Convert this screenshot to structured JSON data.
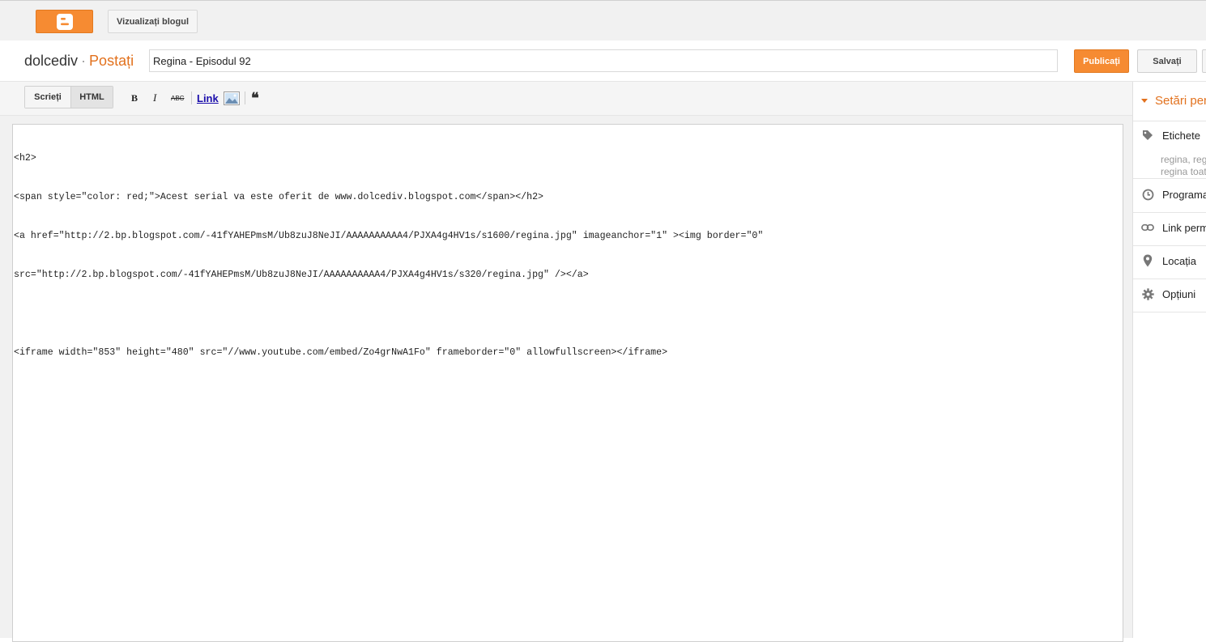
{
  "topbar": {
    "logo_icon": "blogger-logo-icon",
    "view_blog_label": "Vizualizați blogul"
  },
  "header": {
    "blog_name": "dolcediv",
    "separator": "·",
    "section": "Postați",
    "post_title_value": "Regina - Episodul 92",
    "publish_label": "Publicați",
    "save_label": "Salvați"
  },
  "toolbar": {
    "compose_label": "Scrieți",
    "html_label": "HTML",
    "bold_label": "B",
    "italic_label": "I",
    "strike_label": "ABC",
    "link_label": "Link",
    "quote_label": "❝"
  },
  "editor": {
    "lines": [
      "<h2>",
      "<span style=\"color: red;\">Acest serial va este oferit de www.dolcediv.blogspot.com</span></h2>",
      "<a href=\"http://2.bp.blogspot.com/-41fYAHEPmsM/Ub8zuJ8NeJI/AAAAAAAAAA4/PJXA4g4HV1s/s1600/regina.jpg\" imageanchor=\"1\" ><img border=\"0\"",
      "src=\"http://2.bp.blogspot.com/-41fYAHEPmsM/Ub8zuJ8NeJI/AAAAAAAAAA4/PJXA4g4HV1s/s320/regina.jpg\" /></a>",
      "",
      "<iframe width=\"853\" height=\"480\" src=\"//www.youtube.com/embed/Zo4grNwA1Fo\" frameborder=\"0\" allowfullscreen></iframe>"
    ]
  },
  "sidebar": {
    "title": "Setări pentru postare",
    "items": [
      {
        "label": "Etichete",
        "icon": "tag-icon",
        "sub": [
          "regina, regina toate episoadele",
          "regina toate episoadele"
        ]
      },
      {
        "label": "Programați",
        "icon": "clock-icon"
      },
      {
        "label": "Link permanent",
        "icon": "link-icon"
      },
      {
        "label": "Locația",
        "icon": "location-pin-icon"
      },
      {
        "label": "Opțiuni",
        "icon": "gear-icon"
      }
    ]
  }
}
